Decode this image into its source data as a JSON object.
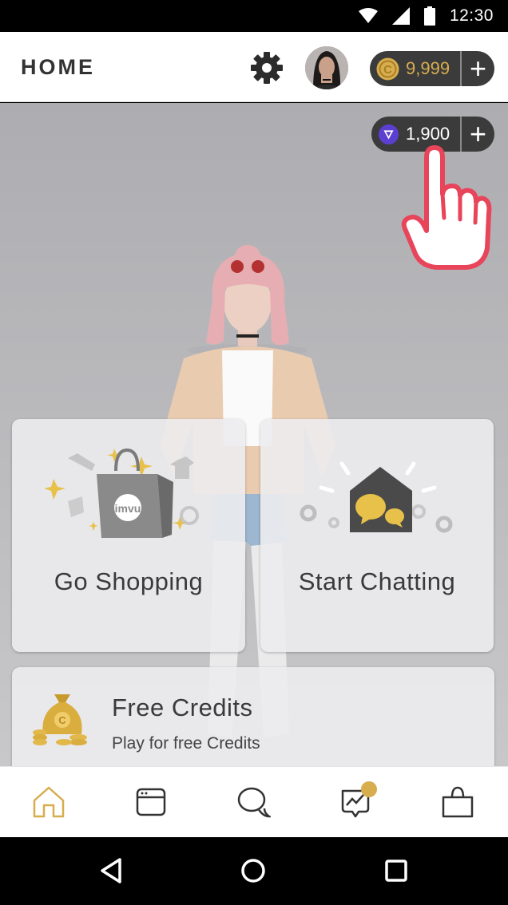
{
  "status_bar": {
    "time": "12:30",
    "icons": [
      "wifi-icon",
      "signal-icon",
      "battery-icon"
    ]
  },
  "header": {
    "title": "HOME",
    "settings_icon": "gear-icon",
    "credits": {
      "value": "9,999",
      "plus": "+"
    },
    "vcoin": {
      "value": "1,900",
      "plus": "+"
    }
  },
  "cards": {
    "shopping": {
      "title": "Go Shopping",
      "icon": "shopping-bag-icon"
    },
    "chatting": {
      "title": "Start Chatting",
      "icon": "chat-house-icon"
    },
    "free_credits": {
      "title": "Free Credits",
      "subtitle": "Play for free Credits",
      "icon": "money-bag-icon"
    }
  },
  "bottom_nav": {
    "items": [
      "home-icon",
      "feed-icon",
      "chat-icon",
      "activity-icon",
      "shop-icon"
    ],
    "active": "home-icon",
    "notification_color": "#d7ad4e"
  },
  "colors": {
    "accent_gold": "#d7ad4e",
    "pill_dark": "#3b3b3b",
    "hand_red": "#e8445a",
    "vcoin_purple": "#5b3fd0"
  }
}
